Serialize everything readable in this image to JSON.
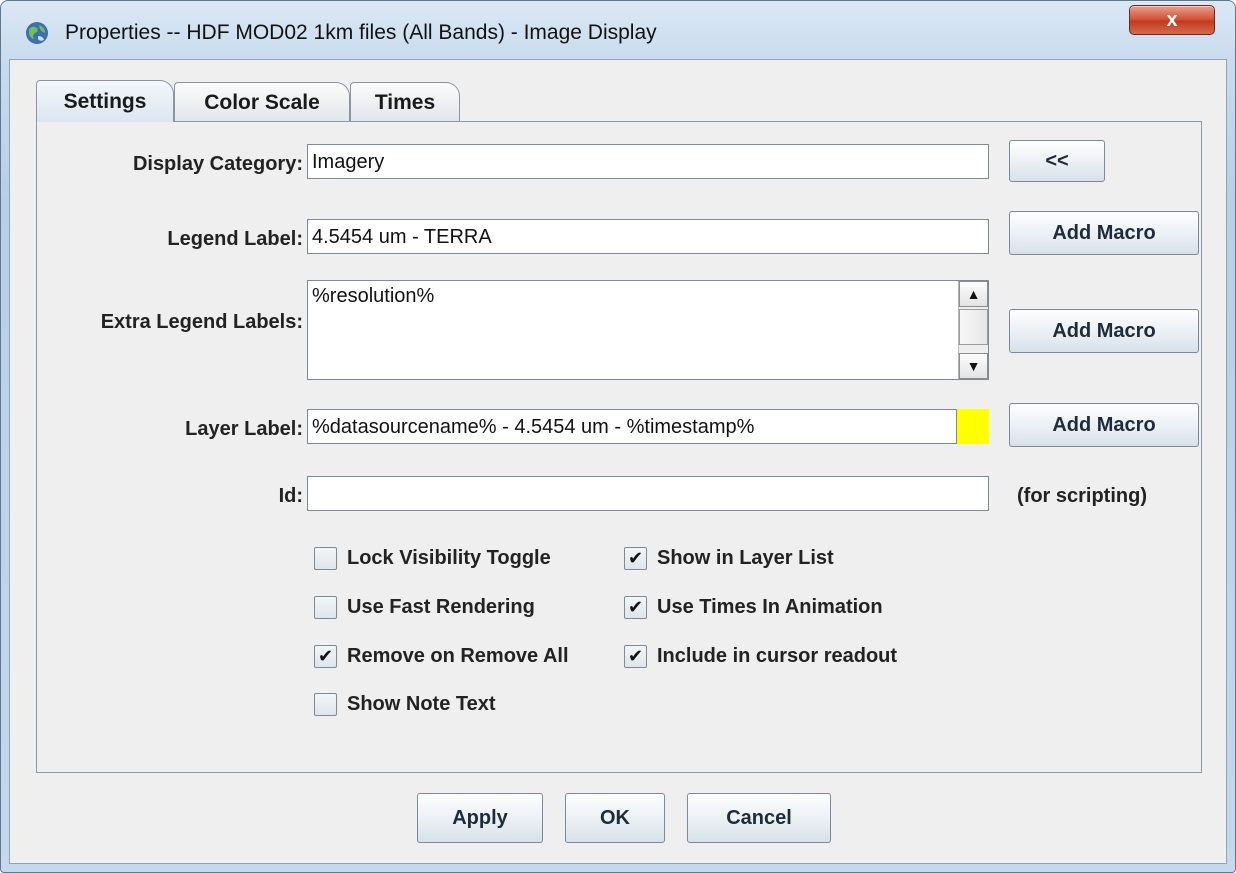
{
  "window": {
    "title": "Properties -- HDF MOD02 1km files (All Bands) - Image Display",
    "close_label": "x"
  },
  "tabs": [
    {
      "label": "Settings",
      "selected": true
    },
    {
      "label": "Color Scale",
      "selected": false
    },
    {
      "label": "Times",
      "selected": false
    }
  ],
  "settings": {
    "display_category": {
      "label": "Display Category:",
      "value": "Imagery",
      "button": "<<"
    },
    "legend_label": {
      "label": "Legend Label:",
      "value": "4.5454 um - TERRA",
      "button": "Add Macro"
    },
    "extra_legend_labels": {
      "label": "Extra Legend Labels:",
      "value": "%resolution%",
      "button": "Add Macro"
    },
    "layer_label": {
      "label": "Layer Label:",
      "value": "%datasourcename% - 4.5454 um - %timestamp%",
      "button": "Add Macro",
      "swatch_color": "#ffff00"
    },
    "id": {
      "label": "Id:",
      "value": "",
      "hint": "(for scripting)"
    }
  },
  "checkboxes": {
    "lock_visibility_toggle": {
      "label": "Lock Visibility Toggle",
      "checked": false
    },
    "show_in_layer_list": {
      "label": "Show in Layer List",
      "checked": true
    },
    "use_fast_rendering": {
      "label": "Use Fast Rendering",
      "checked": false
    },
    "use_times_in_animation": {
      "label": "Use Times In Animation",
      "checked": true
    },
    "remove_on_remove_all": {
      "label": "Remove on Remove All",
      "checked": true
    },
    "include_in_cursor_readout": {
      "label": "Include in cursor readout",
      "checked": true
    },
    "show_note_text": {
      "label": "Show Note Text",
      "checked": false
    }
  },
  "footer": {
    "apply_label": "Apply",
    "ok_label": "OK",
    "cancel_label": "Cancel"
  },
  "check_glyph": "✔"
}
